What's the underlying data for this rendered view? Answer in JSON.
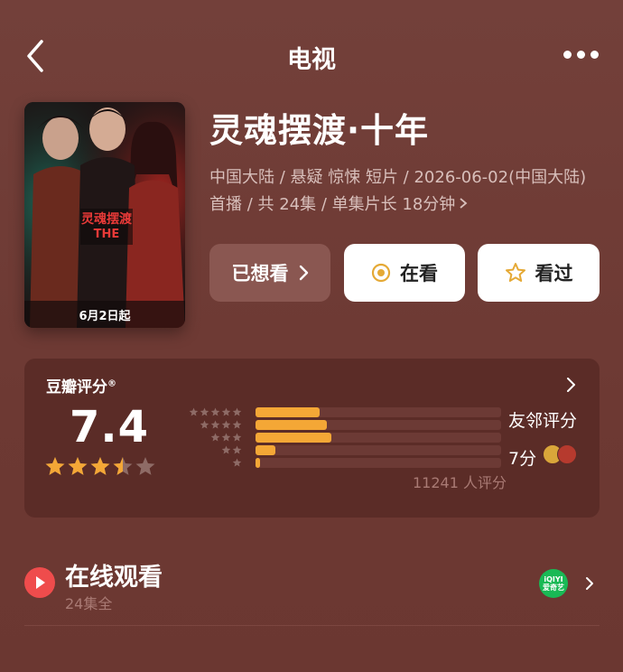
{
  "nav": {
    "title": "电视",
    "back_icon": "chevron-left-icon",
    "more_icon": "more-dots-icon"
  },
  "poster": {
    "date_label": "6月2日起",
    "logo_text": "灵魂摆渡"
  },
  "show": {
    "title": "灵魂摆渡·十年",
    "meta": "中国大陆 / 悬疑 惊悚 短片 / 2026-06-02(中国大陆) 首播 / 共 24集 / 单集片长 18分钟"
  },
  "actions": {
    "wanted_label": "已想看",
    "watching_label": "在看",
    "watched_label": "看过"
  },
  "rating": {
    "label": "豆瓣评分",
    "registered_mark": "®",
    "score": "7.4",
    "star_level": 3.5,
    "star_max": 5,
    "distribution": [
      {
        "stars": 5,
        "fraction": 0.26
      },
      {
        "stars": 4,
        "fraction": 0.29
      },
      {
        "stars": 3,
        "fraction": 0.31
      },
      {
        "stars": 2,
        "fraction": 0.08
      },
      {
        "stars": 1,
        "fraction": 0.02
      }
    ],
    "friend_label": "友邻评分",
    "friend_score": "7分",
    "count_text": "11241 人评分"
  },
  "online": {
    "title": "在线观看",
    "subtitle": "24集全",
    "provider_name_en": "iQIYI",
    "provider_name_cn": "爱奇艺"
  },
  "colors": {
    "background": "#6f3a34",
    "card": "#5b2c27",
    "accent_gold": "#f4a736",
    "play_red": "#ef4c4c",
    "iqiyi_green": "#19b955"
  }
}
